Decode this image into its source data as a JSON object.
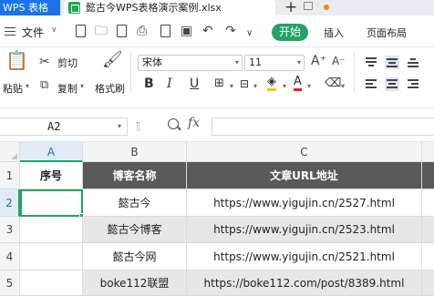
{
  "titlebar": {
    "app_tab": "WPS 表格",
    "document_tab": "懿古今WPS表格演示案例.xlsx",
    "new_tab": "+"
  },
  "menubar": {
    "file": "文件",
    "start": "开始",
    "insert": "插入",
    "page_layout": "页面布局"
  },
  "ribbon": {
    "paste": "粘贴",
    "cut": "剪切",
    "copy": "复制",
    "format_painter": "格式刷",
    "font_name": "宋体",
    "font_size": "11",
    "bold": "B",
    "italic": "I",
    "underline": "U"
  },
  "formula_bar": {
    "cell_ref": "A2",
    "fx": "fx",
    "formula": ""
  },
  "sheet": {
    "columns": [
      "A",
      "B",
      "C"
    ],
    "rows": [
      "1",
      "2",
      "3",
      "4",
      "5"
    ],
    "header": [
      "序号",
      "博客名称",
      "文章URL地址"
    ],
    "data": [
      [
        "",
        "懿古今",
        "https://www.yigujin.cn/2527.html"
      ],
      [
        "",
        "懿古今博客",
        "https://www.yigujin.cn/2523.html"
      ],
      [
        "",
        "懿古今网",
        "https://www.yigujin.cn/2521.html"
      ],
      [
        "",
        "boke112联盟",
        "https://boke112.com/post/8389.html"
      ]
    ],
    "selected_cell": "A2"
  },
  "colors": {
    "accent": "#21a366",
    "app_tab": "#1a73e8",
    "header_dark": "#595959",
    "stripe": "#e7e7e7"
  }
}
